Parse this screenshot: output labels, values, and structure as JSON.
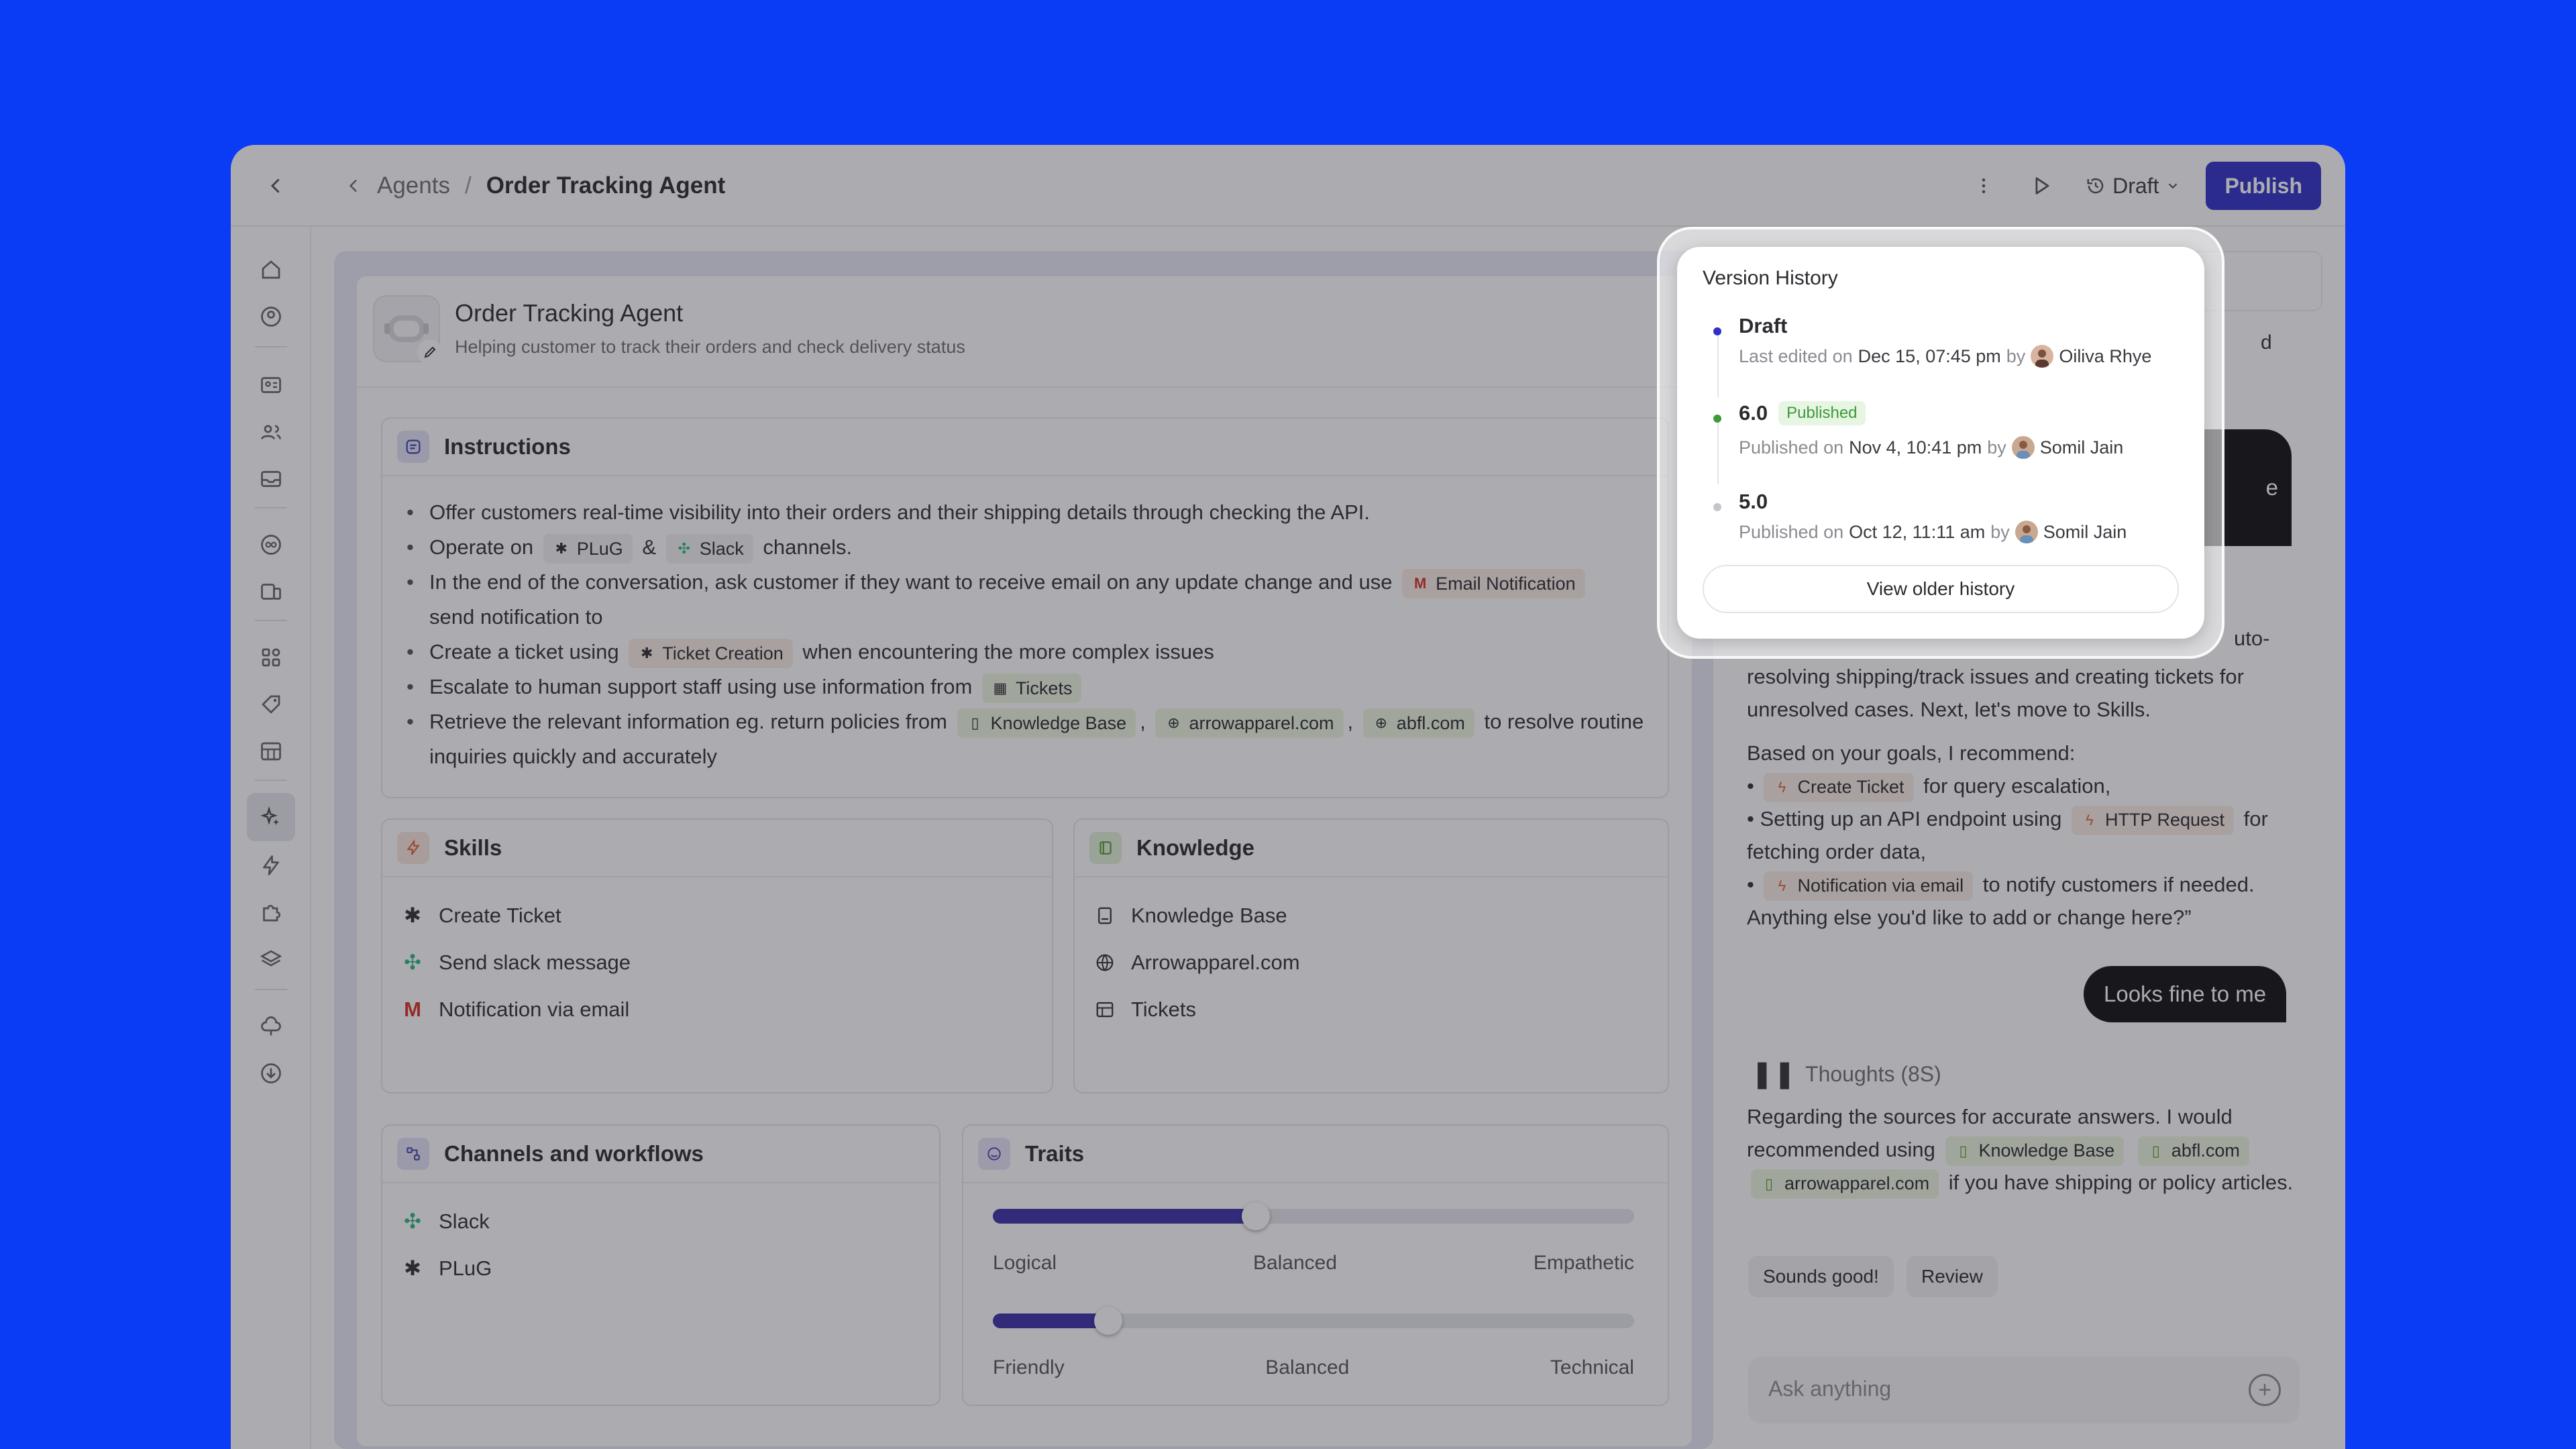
{
  "header": {
    "back_icon": "chevron-left-icon",
    "breadcrumb_parent": "Agents",
    "breadcrumb_sep": "/",
    "breadcrumb_current": "Order Tracking Agent",
    "draft_label": "Draft",
    "publish_label": "Publish"
  },
  "rail": {
    "icons": [
      "home-icon",
      "user-circle-icon",
      "id-card-icon",
      "users-icon",
      "inbox-icon",
      "infinity-icon",
      "devices-icon",
      "apps-icon",
      "tag-icon",
      "table-icon",
      "sparkle-icon",
      "bolt-icon",
      "puzzle-icon",
      "layers-icon",
      "cloud-icon",
      "download-icon"
    ],
    "active": "sparkle-icon"
  },
  "agent": {
    "name": "Order Tracking Agent",
    "description": "Helping customer to track their orders and check delivery status"
  },
  "instructions": {
    "title": "Instructions",
    "l1": "Offer customers real-time visibility into their orders and their shipping details through checking the API.",
    "l2_a": "Operate on",
    "l2_chip1": "PLuG",
    "l2_amp": "&",
    "l2_chip2": "Slack",
    "l2_b": "channels.",
    "l3_a": "In the end of the conversation, ask customer if they want to receive email on any update change and use",
    "l3_chip": "Email Notification",
    "l3_b": "send notification to",
    "l4_a": "Create a ticket using",
    "l4_chip": "Ticket Creation",
    "l4_b": "when encountering the more complex issues",
    "l5_a": "Escalate to human support staff using use information from",
    "l5_chip": "Tickets",
    "l6_a": "Retrieve the relevant information eg. return policies from",
    "l6_chip1": "Knowledge Base",
    "l6_chip2": "arrowapparel.com",
    "l6_chip3": "abfl.com",
    "l6_b": "to resolve routine inquiries quickly and accurately",
    "comma": ","
  },
  "skills": {
    "title": "Skills",
    "items": [
      "Create Ticket",
      "Send slack message",
      "Notification via email"
    ]
  },
  "knowledge": {
    "title": "Knowledge",
    "items": [
      "Knowledge Base",
      "Arrowapparel.com",
      "Tickets"
    ]
  },
  "channels": {
    "title": "Channels and workflows",
    "items": [
      "Slack",
      "PLuG"
    ]
  },
  "traits": {
    "title": "Traits",
    "sliders": [
      {
        "left": "Logical",
        "mid": "Balanced",
        "right": "Empathetic",
        "value": 0.41
      },
      {
        "left": "Friendly",
        "mid": "Balanced",
        "right": "Technical",
        "value": 0.18
      }
    ]
  },
  "chat": {
    "partial_top": "d",
    "partial_bubble": "e",
    "partial_para": "uto-",
    "para1": "resolving shipping/track issues and creating tickets for unresolved cases. Next, let's move to Skills.",
    "rec_intro": "Based on your goals, I recommend:",
    "rec1_chip": "Create Ticket",
    "rec1_b": "for query escalation,",
    "rec2_a": "Setting up an API endpoint using",
    "rec2_chip": "HTTP Request",
    "rec2_b": "for fetching order data,",
    "rec3_chip": "Notification via email",
    "rec3_b": "to notify customers if needed.",
    "rec_outro": "Anything else you'd like to add or change here?”",
    "user_reply": "Looks fine to me",
    "thoughts": "Thoughts (8S)",
    "t_a": "Regarding the sources for accurate answers. I would recommended using",
    "t_chip1": "Knowledge Base",
    "t_chip2": "abfl.com",
    "t_chip3": "arrowapparel.com",
    "t_b": "if you have shipping or policy articles.",
    "sugg1": "Sounds good!",
    "sugg2": "Review",
    "ask_placeholder": "Ask anything"
  },
  "version_history": {
    "title": "Version History",
    "versions": [
      {
        "name": "Draft",
        "badge": "",
        "meta_prefix": "Last edited on",
        "date": "Dec 15, 07:45 pm",
        "by": "by",
        "user": "Oiliva Rhye",
        "dot": "#2f2fc8"
      },
      {
        "name": "6.0",
        "badge": "Published",
        "meta_prefix": "Published on",
        "date": "Nov 4, 10:41 pm",
        "by": "by",
        "user": "Somil Jain",
        "dot": "#3d9a3a"
      },
      {
        "name": "5.0",
        "badge": "",
        "meta_prefix": "Published on",
        "date": "Oct 12, 11:11 am",
        "by": "by",
        "user": "Somil Jain",
        "dot": "#c4c4ca"
      }
    ],
    "older_label": "View older history"
  },
  "colors": {
    "brand": "#2f2fc8",
    "background": "#0a3cf5",
    "published": "#3d9a3a"
  }
}
